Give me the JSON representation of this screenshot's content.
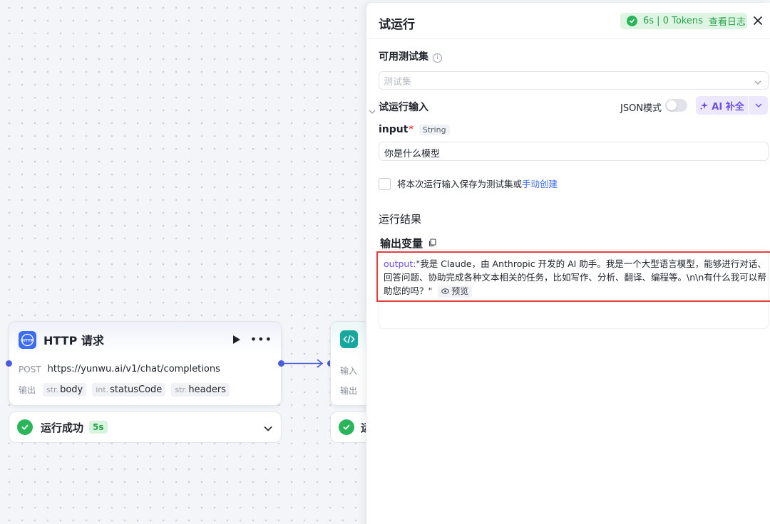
{
  "canvas": {
    "http_node": {
      "icon_text": "HTTP",
      "title": "HTTP 请求",
      "method": "POST",
      "url": "https://yunwu.ai/v1/chat/completions",
      "output_label": "输出",
      "outputs": [
        {
          "type": "str.",
          "name": "body"
        },
        {
          "type": "int.",
          "name": "statusCode"
        },
        {
          "type": "str.",
          "name": "headers"
        }
      ],
      "status_text": "运行成功",
      "status_time": "5s"
    },
    "code_node": {
      "input_label": "输入",
      "output_label": "输出",
      "status_text": "运"
    }
  },
  "panel": {
    "title": "试运行",
    "run_time_tokens": "6s | 0 Tokens",
    "view_log": "查看日志",
    "testset_label": "可用测试集",
    "testset_placeholder": "测试集",
    "run_input_label": "试运行输入",
    "json_mode_label": "JSON模式",
    "json_mode_on": false,
    "ai_button": "AI 补全",
    "input_name": "input",
    "input_required": "*",
    "input_type": "String",
    "input_value": "你是什么模型",
    "save_text": "将本次运行输入保存为测试集或",
    "save_link": "手动创建",
    "results_label": "运行结果",
    "output_vars_label": "输出变量",
    "output_key": "output",
    "output_sep": ":",
    "output_value": "\"我是 Claude，由 Anthropic 开发的 AI 助手。我是一个大型语言模型，能够进行对话、回答问题、协助完成各种文本相关的任务，比如写作、分析、翻译、编程等。\\n\\n有什么我可以帮助您的吗？\"",
    "preview_label": "预览"
  },
  "colors": {
    "accent_purple": "#6a4ee8",
    "success_green": "#2bb55a",
    "link_blue": "#3d6df0",
    "highlight_red": "#e53e3e"
  }
}
